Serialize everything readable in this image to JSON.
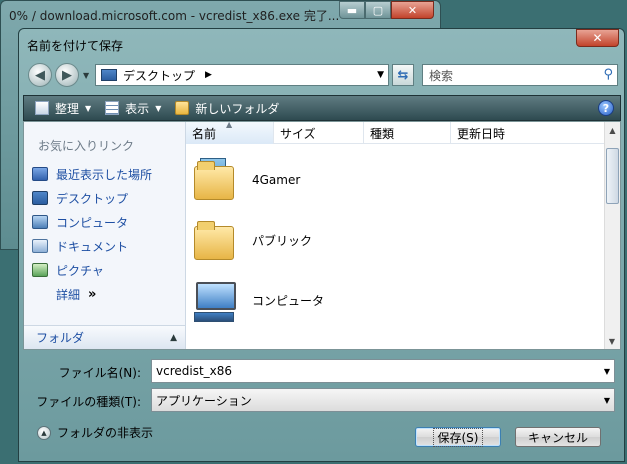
{
  "background_window": {
    "title": "0% / download.microsoft.com - vcredist_x86.exe 完了..."
  },
  "dialog": {
    "title": "名前を付けて保存",
    "address": {
      "location": "デスクトップ",
      "search_placeholder": "検索"
    },
    "toolbar": {
      "organize": "整理",
      "view": "表示",
      "new_folder": "新しいフォルダ"
    },
    "nav_pane": {
      "favorites_header": "お気に入りリンク",
      "items": [
        {
          "label": "最近表示した場所",
          "icon": "recent-places-icon"
        },
        {
          "label": "デスクトップ",
          "icon": "desktop-icon"
        },
        {
          "label": "コンピュータ",
          "icon": "computer-icon"
        },
        {
          "label": "ドキュメント",
          "icon": "documents-icon"
        },
        {
          "label": "ピクチャ",
          "icon": "pictures-icon"
        }
      ],
      "more": "詳細",
      "folders": "フォルダ"
    },
    "columns": [
      "名前",
      "サイズ",
      "種類",
      "更新日時"
    ],
    "files": [
      {
        "name": "4Gamer",
        "icon": "folder-with-content-icon"
      },
      {
        "name": "パブリック",
        "icon": "folder-icon"
      },
      {
        "name": "コンピュータ",
        "icon": "computer-icon"
      }
    ],
    "form": {
      "filename_label": "ファイル名(N):",
      "filename_value": "vcredist_x86",
      "filetype_label": "ファイルの種類(T):",
      "filetype_value": "アプリケーション"
    },
    "hide_folders": "フォルダの非表示",
    "save_button": "保存(S)",
    "cancel_button": "キャンセル"
  }
}
